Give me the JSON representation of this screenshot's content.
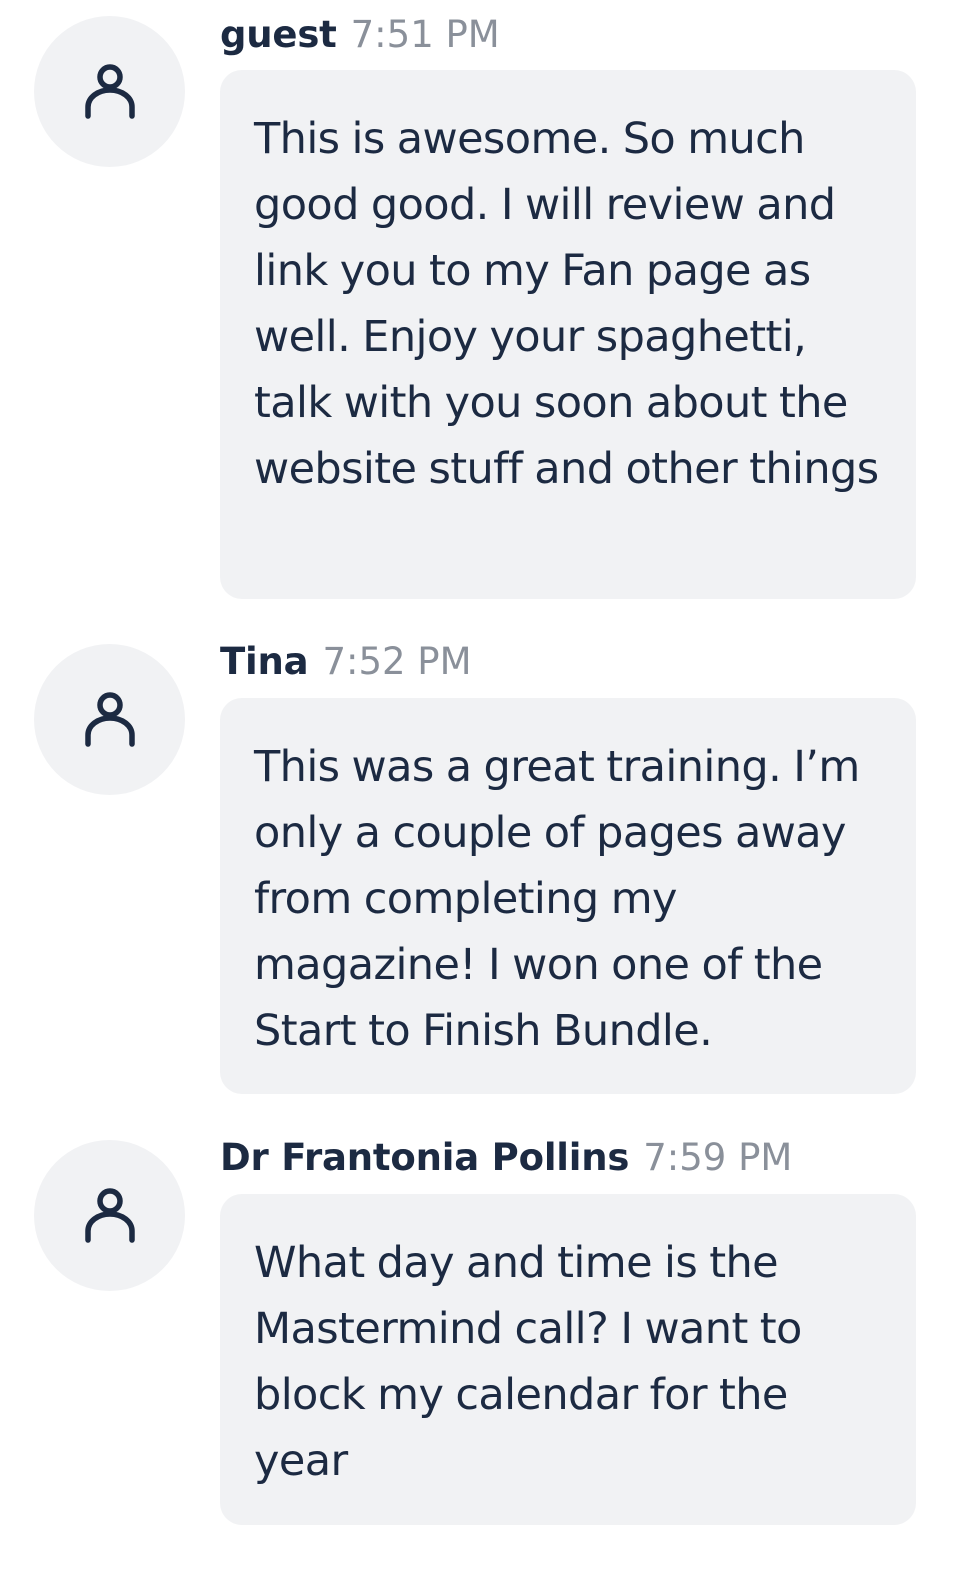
{
  "messages": [
    {
      "sender": "guest",
      "time": "7:51 PM",
      "text": "This is awesome. So much good good. I will review and link you to my Fan page as well. Enjoy your spaghetti, talk with you soon about the website stuff and other things",
      "avatar_icon": "user-icon"
    },
    {
      "sender": "Tina",
      "time": "7:52 PM",
      "text": "This was a great training. I’m only a couple of pages away from completing my magazine! I won one of the Start to Finish Bundle.",
      "avatar_icon": "user-icon"
    },
    {
      "sender": "Dr Frantonia Pollins",
      "time": "7:59 PM",
      "text": "What day and time is the Mastermind call? I want to block my calendar for the year",
      "avatar_icon": "user-icon"
    }
  ],
  "colors": {
    "text": "#1c2a42",
    "timestamp": "#8a909a",
    "bubble_bg": "#f1f2f4",
    "avatar_bg": "#f1f2f4"
  }
}
